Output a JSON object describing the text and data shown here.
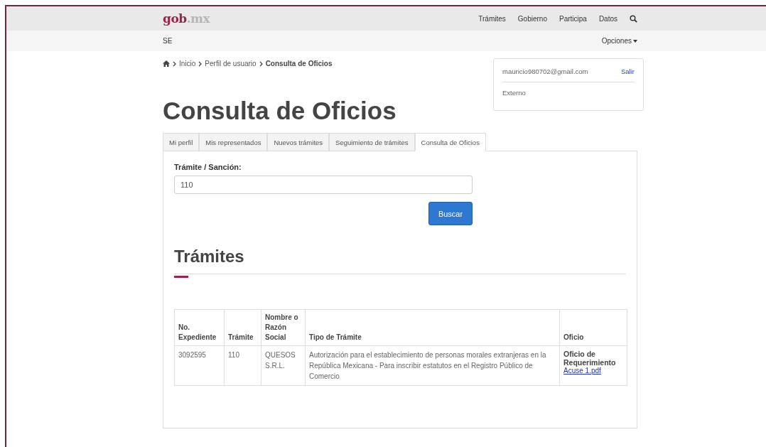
{
  "header": {
    "logo_main": "gob",
    "logo_suffix": ".mx",
    "nav": [
      "Trámites",
      "Gobierno",
      "Participa",
      "Datos"
    ]
  },
  "subheader": {
    "title": "SE",
    "menu": "Opciones"
  },
  "breadcrumb": [
    {
      "label": "Inicio",
      "current": false
    },
    {
      "label": "Perfil de usuario",
      "current": false
    },
    {
      "label": "Consulta de Oficios",
      "current": true
    }
  ],
  "user_box": {
    "email": "mauricio980702@gmail.com",
    "logout": "Salir",
    "role": "Externo"
  },
  "page_title": "Consulta de Oficios",
  "tabs": [
    {
      "label": "Mi perfil",
      "selected": false
    },
    {
      "label": "Mis representados",
      "selected": false
    },
    {
      "label": "Nuevos trámites",
      "selected": false
    },
    {
      "label": "Seguimiento de trámites",
      "selected": false
    },
    {
      "label": "Consulta de Oficios",
      "selected": true
    }
  ],
  "search": {
    "label": "Trámite / Sanción:",
    "value": "110",
    "button": "Buscar"
  },
  "section_title": "Trámites",
  "table": {
    "columns": [
      "No. Expediente",
      "Trámite",
      "Nombre o Razón Social",
      "Tipo de Trámite",
      "Oficio"
    ],
    "rows": [
      {
        "expediente": "3092595",
        "tramite": "110",
        "nombre": "QUESOS S.R.L.",
        "tipo": "Autorización para el establecimiento de personas morales extranjeras en la República Mexicana - Para inscribir estatutos en el Registro Público de Comercio",
        "oficio_title": "Oficio de Requerimiento",
        "oficio_link": "Acuse 1.pdf"
      }
    ]
  }
}
